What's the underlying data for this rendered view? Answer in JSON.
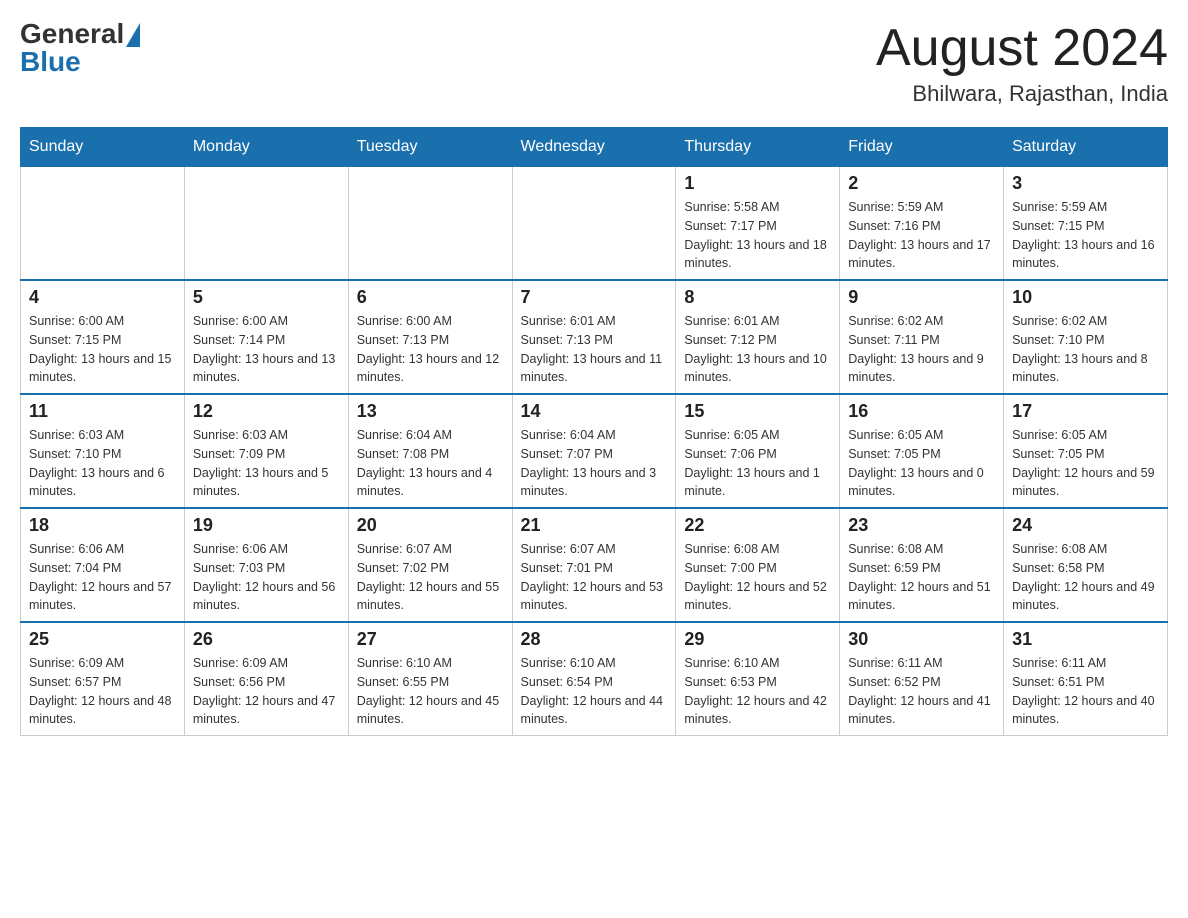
{
  "header": {
    "logo_general": "General",
    "logo_blue": "Blue",
    "month_year": "August 2024",
    "location": "Bhilwara, Rajasthan, India"
  },
  "days_of_week": [
    "Sunday",
    "Monday",
    "Tuesday",
    "Wednesday",
    "Thursday",
    "Friday",
    "Saturday"
  ],
  "weeks": [
    [
      {
        "day": "",
        "info": ""
      },
      {
        "day": "",
        "info": ""
      },
      {
        "day": "",
        "info": ""
      },
      {
        "day": "",
        "info": ""
      },
      {
        "day": "1",
        "info": "Sunrise: 5:58 AM\nSunset: 7:17 PM\nDaylight: 13 hours and 18 minutes."
      },
      {
        "day": "2",
        "info": "Sunrise: 5:59 AM\nSunset: 7:16 PM\nDaylight: 13 hours and 17 minutes."
      },
      {
        "day": "3",
        "info": "Sunrise: 5:59 AM\nSunset: 7:15 PM\nDaylight: 13 hours and 16 minutes."
      }
    ],
    [
      {
        "day": "4",
        "info": "Sunrise: 6:00 AM\nSunset: 7:15 PM\nDaylight: 13 hours and 15 minutes."
      },
      {
        "day": "5",
        "info": "Sunrise: 6:00 AM\nSunset: 7:14 PM\nDaylight: 13 hours and 13 minutes."
      },
      {
        "day": "6",
        "info": "Sunrise: 6:00 AM\nSunset: 7:13 PM\nDaylight: 13 hours and 12 minutes."
      },
      {
        "day": "7",
        "info": "Sunrise: 6:01 AM\nSunset: 7:13 PM\nDaylight: 13 hours and 11 minutes."
      },
      {
        "day": "8",
        "info": "Sunrise: 6:01 AM\nSunset: 7:12 PM\nDaylight: 13 hours and 10 minutes."
      },
      {
        "day": "9",
        "info": "Sunrise: 6:02 AM\nSunset: 7:11 PM\nDaylight: 13 hours and 9 minutes."
      },
      {
        "day": "10",
        "info": "Sunrise: 6:02 AM\nSunset: 7:10 PM\nDaylight: 13 hours and 8 minutes."
      }
    ],
    [
      {
        "day": "11",
        "info": "Sunrise: 6:03 AM\nSunset: 7:10 PM\nDaylight: 13 hours and 6 minutes."
      },
      {
        "day": "12",
        "info": "Sunrise: 6:03 AM\nSunset: 7:09 PM\nDaylight: 13 hours and 5 minutes."
      },
      {
        "day": "13",
        "info": "Sunrise: 6:04 AM\nSunset: 7:08 PM\nDaylight: 13 hours and 4 minutes."
      },
      {
        "day": "14",
        "info": "Sunrise: 6:04 AM\nSunset: 7:07 PM\nDaylight: 13 hours and 3 minutes."
      },
      {
        "day": "15",
        "info": "Sunrise: 6:05 AM\nSunset: 7:06 PM\nDaylight: 13 hours and 1 minute."
      },
      {
        "day": "16",
        "info": "Sunrise: 6:05 AM\nSunset: 7:05 PM\nDaylight: 13 hours and 0 minutes."
      },
      {
        "day": "17",
        "info": "Sunrise: 6:05 AM\nSunset: 7:05 PM\nDaylight: 12 hours and 59 minutes."
      }
    ],
    [
      {
        "day": "18",
        "info": "Sunrise: 6:06 AM\nSunset: 7:04 PM\nDaylight: 12 hours and 57 minutes."
      },
      {
        "day": "19",
        "info": "Sunrise: 6:06 AM\nSunset: 7:03 PM\nDaylight: 12 hours and 56 minutes."
      },
      {
        "day": "20",
        "info": "Sunrise: 6:07 AM\nSunset: 7:02 PM\nDaylight: 12 hours and 55 minutes."
      },
      {
        "day": "21",
        "info": "Sunrise: 6:07 AM\nSunset: 7:01 PM\nDaylight: 12 hours and 53 minutes."
      },
      {
        "day": "22",
        "info": "Sunrise: 6:08 AM\nSunset: 7:00 PM\nDaylight: 12 hours and 52 minutes."
      },
      {
        "day": "23",
        "info": "Sunrise: 6:08 AM\nSunset: 6:59 PM\nDaylight: 12 hours and 51 minutes."
      },
      {
        "day": "24",
        "info": "Sunrise: 6:08 AM\nSunset: 6:58 PM\nDaylight: 12 hours and 49 minutes."
      }
    ],
    [
      {
        "day": "25",
        "info": "Sunrise: 6:09 AM\nSunset: 6:57 PM\nDaylight: 12 hours and 48 minutes."
      },
      {
        "day": "26",
        "info": "Sunrise: 6:09 AM\nSunset: 6:56 PM\nDaylight: 12 hours and 47 minutes."
      },
      {
        "day": "27",
        "info": "Sunrise: 6:10 AM\nSunset: 6:55 PM\nDaylight: 12 hours and 45 minutes."
      },
      {
        "day": "28",
        "info": "Sunrise: 6:10 AM\nSunset: 6:54 PM\nDaylight: 12 hours and 44 minutes."
      },
      {
        "day": "29",
        "info": "Sunrise: 6:10 AM\nSunset: 6:53 PM\nDaylight: 12 hours and 42 minutes."
      },
      {
        "day": "30",
        "info": "Sunrise: 6:11 AM\nSunset: 6:52 PM\nDaylight: 12 hours and 41 minutes."
      },
      {
        "day": "31",
        "info": "Sunrise: 6:11 AM\nSunset: 6:51 PM\nDaylight: 12 hours and 40 minutes."
      }
    ]
  ]
}
